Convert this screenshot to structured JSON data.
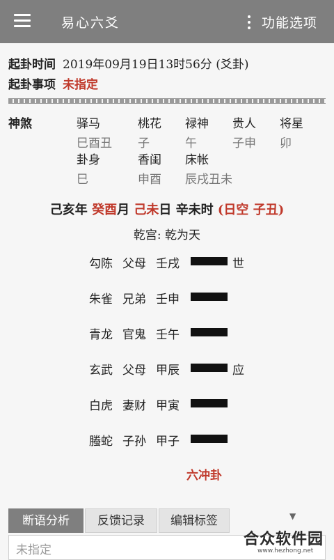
{
  "header": {
    "title": "易心六爻",
    "menu_label": "功能选项"
  },
  "info": {
    "time_key": "起卦时间",
    "time_value": "2019年09月19日13时56分 (爻卦)",
    "matter_key": "起卦事项",
    "matter_value": "未指定"
  },
  "shensha": {
    "label": "神煞",
    "items": [
      {
        "name": "驿马",
        "value": "巳酉丑"
      },
      {
        "name": "桃花",
        "value": "子"
      },
      {
        "name": "禄神",
        "value": "午"
      },
      {
        "name": "贵人",
        "value": "子申"
      },
      {
        "name": "将星",
        "value": "卯"
      },
      {
        "name": "卦身",
        "value": "巳"
      },
      {
        "name": "香闺",
        "value": "申酉"
      },
      {
        "name": "床帐",
        "value": "辰戌丑未"
      }
    ]
  },
  "ganzhi": {
    "year": "己亥年",
    "month_gz": "癸酉",
    "month_suffix": "月",
    "day_gz": "己未",
    "day_suffix": "日",
    "hour": "辛未时",
    "kong": "(日空 子丑)"
  },
  "palace": "乾宫: 乾为天",
  "yaos": [
    {
      "god": "勾陈",
      "relation": "父母",
      "ganzhi": "壬戌",
      "mark": "世"
    },
    {
      "god": "朱雀",
      "relation": "兄弟",
      "ganzhi": "壬申",
      "mark": ""
    },
    {
      "god": "青龙",
      "relation": "官鬼",
      "ganzhi": "壬午",
      "mark": ""
    },
    {
      "god": "玄武",
      "relation": "父母",
      "ganzhi": "甲辰",
      "mark": "应"
    },
    {
      "god": "白虎",
      "relation": "妻财",
      "ganzhi": "甲寅",
      "mark": ""
    },
    {
      "god": "螣蛇",
      "relation": "子孙",
      "ganzhi": "甲子",
      "mark": ""
    }
  ],
  "hexagram_type": "六冲卦",
  "tabs": [
    "断语分析",
    "反馈记录",
    "编辑标签"
  ],
  "notes_text": "未指定",
  "watermark": {
    "name": "合众软件园",
    "url": "www.hezhong.net"
  },
  "colors": {
    "topbar": "#7f7f7f",
    "accent_red": "#c0392b"
  }
}
